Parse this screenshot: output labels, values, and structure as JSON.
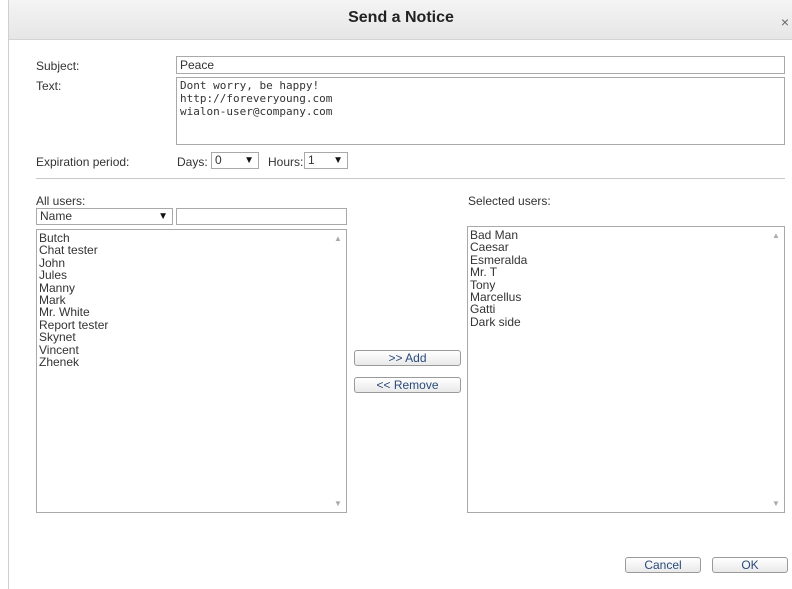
{
  "dialog": {
    "title": "Send a Notice",
    "close_glyph": "×"
  },
  "form": {
    "subject_label": "Subject:",
    "subject_value": "Peace",
    "text_label": "Text:",
    "text_lines": [
      "Dont worry, be happy!",
      "http://foreveryoung.com",
      "wialon-user@company.com"
    ],
    "expiration_label": "Expiration period:",
    "days_label": "Days:",
    "days_value": "0",
    "hours_label": "Hours:",
    "hours_value": "1"
  },
  "all_users": {
    "label": "All users:",
    "filter_field": "Name",
    "filter_value": "",
    "items": [
      "Butch",
      "Chat tester",
      "John",
      "Jules",
      "Manny",
      "Mark",
      "Mr. White",
      "Report tester",
      "Skynet",
      "Vincent",
      "Zhenek"
    ]
  },
  "selected_users": {
    "label": "Selected users:",
    "items": [
      "Bad Man",
      "Caesar",
      "Esmeralda",
      "Mr. T",
      "Tony",
      "Marcellus",
      "Gatti",
      "Dark side"
    ]
  },
  "actions": {
    "add_label": ">> Add",
    "remove_label": "<< Remove",
    "cancel_label": "Cancel",
    "ok_label": "OK"
  },
  "glyphs": {
    "dropdown": "▼",
    "scroll_up": "▲",
    "scroll_down": "▼"
  }
}
